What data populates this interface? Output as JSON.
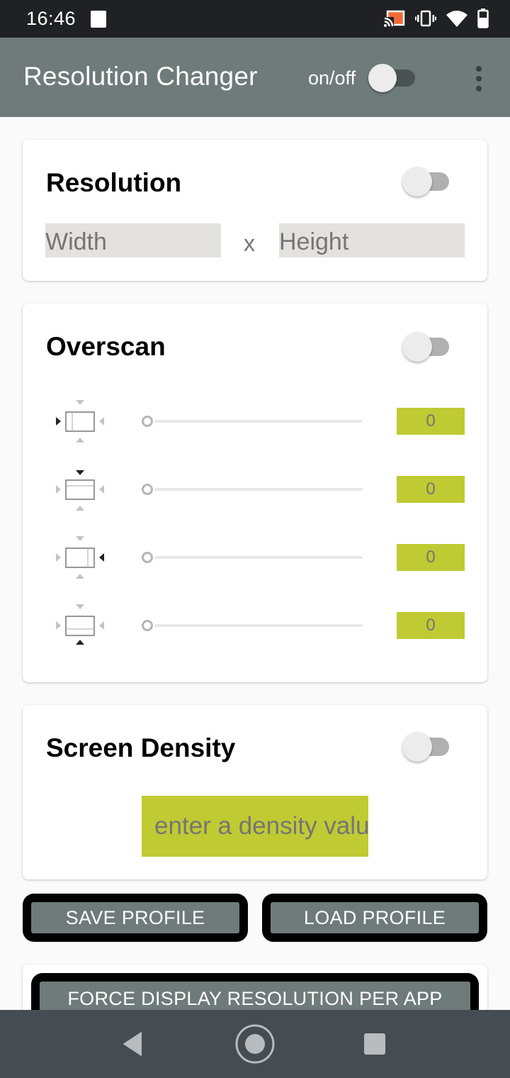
{
  "status_bar": {
    "time": "16:46",
    "icons": [
      "notification-icon",
      "cast-icon",
      "vibrate-icon",
      "wifi-icon",
      "battery-icon"
    ],
    "cast_color": "#f26b3a"
  },
  "app_bar": {
    "title": "Resolution Changer",
    "onoff_label": "on/off",
    "master_switch_on": false,
    "menu_icon": "overflow-menu-icon",
    "color": "#6e7b7a"
  },
  "resolution": {
    "title": "Resolution",
    "enabled": false,
    "width_placeholder": "Width",
    "width_value": "",
    "separator": "x",
    "height_placeholder": "Height",
    "height_value": ""
  },
  "overscan": {
    "title": "Overscan",
    "enabled": false,
    "rows": [
      {
        "edge": "left",
        "icon": "overscan-left-icon",
        "slider_value": 0,
        "value": "0"
      },
      {
        "edge": "top",
        "icon": "overscan-top-icon",
        "slider_value": 0,
        "value": "0"
      },
      {
        "edge": "right",
        "icon": "overscan-right-icon",
        "slider_value": 0,
        "value": "0"
      },
      {
        "edge": "bottom",
        "icon": "overscan-bottom-icon",
        "slider_value": 0,
        "value": "0"
      }
    ],
    "accent": "#c0ca33"
  },
  "density": {
    "title": "Screen Density",
    "enabled": false,
    "placeholder": "enter a density value",
    "value": ""
  },
  "buttons": {
    "save_profile": "SAVE PROFILE",
    "load_profile": "LOAD PROFILE",
    "force_per_app": "FORCE DISPLAY RESOLUTION PER APP"
  },
  "nav_bar": {
    "back": "back-icon",
    "home": "home-icon",
    "recents": "recents-icon"
  }
}
